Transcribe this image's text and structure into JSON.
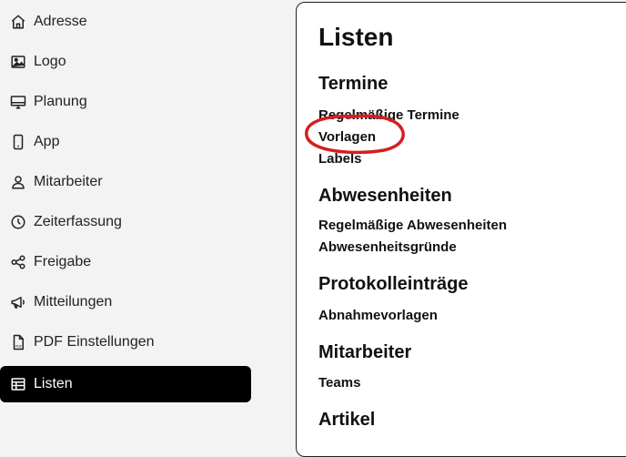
{
  "sidebar": {
    "items": [
      {
        "label": "Adresse",
        "icon": "home-icon"
      },
      {
        "label": "Logo",
        "icon": "image-icon"
      },
      {
        "label": "Planung",
        "icon": "monitor-icon"
      },
      {
        "label": "App",
        "icon": "smartphone-icon"
      },
      {
        "label": "Mitarbeiter",
        "icon": "user-icon"
      },
      {
        "label": "Zeiterfassung",
        "icon": "clock-icon"
      },
      {
        "label": "Freigabe",
        "icon": "share-icon"
      },
      {
        "label": "Mitteilungen",
        "icon": "megaphone-icon"
      },
      {
        "label": "PDF Einstellungen",
        "icon": "pdf-file-icon"
      },
      {
        "label": "Listen",
        "icon": "table-icon",
        "active": true
      }
    ]
  },
  "panel": {
    "title": "Listen",
    "sections": [
      {
        "title": "Termine",
        "links": [
          "Regelmäßige Termine",
          "Vorlagen",
          "Labels"
        ]
      },
      {
        "title": "Abwesenheiten",
        "links": [
          "Regelmäßige Abwesenheiten",
          "Abwesenheitsgründe"
        ]
      },
      {
        "title": "Protokolleinträge",
        "links": [
          "Abnahmevorlagen"
        ]
      },
      {
        "title": "Mitarbeiter",
        "links": [
          "Teams"
        ]
      },
      {
        "title": "Artikel",
        "links": []
      }
    ]
  },
  "colors": {
    "background": "#f3f3f3",
    "active_bg": "#000000",
    "active_text": "#ffffff",
    "annotation": "#d61f1f"
  }
}
